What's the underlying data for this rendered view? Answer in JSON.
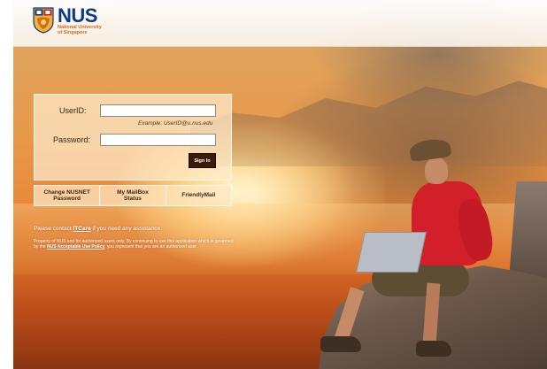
{
  "header": {
    "logo_text": "NUS",
    "logo_sub_line1": "National University",
    "logo_sub_line2": "of Singapore"
  },
  "login": {
    "userid_label": "UserID:",
    "userid_value": "",
    "userid_placeholder": "",
    "example_text": "Example: UserID@u.nus.edu",
    "password_label": "Password:",
    "password_value": "",
    "signin_label": "Sign In"
  },
  "quick_links": [
    {
      "line1": "Change NUSNET",
      "line2": "Password"
    },
    {
      "line1": "My MailBox",
      "line2": "Status"
    },
    {
      "line1": "FriendlyMail",
      "line2": ""
    }
  ],
  "assist": {
    "prefix": "Please contact ",
    "link": "ITCare",
    "suffix": " if you need any assistance."
  },
  "policy": {
    "part1": "Property of NUS and for authorized users only. By continuing to use this application which is governed by the ",
    "link": "NUS Acceptable Use Policy",
    "part2": ", you represent that you are an authorized user."
  },
  "colors": {
    "brand_blue": "#0b3b86",
    "brand_orange": "#d46a1b",
    "signin_bg": "#3b1a0a"
  }
}
